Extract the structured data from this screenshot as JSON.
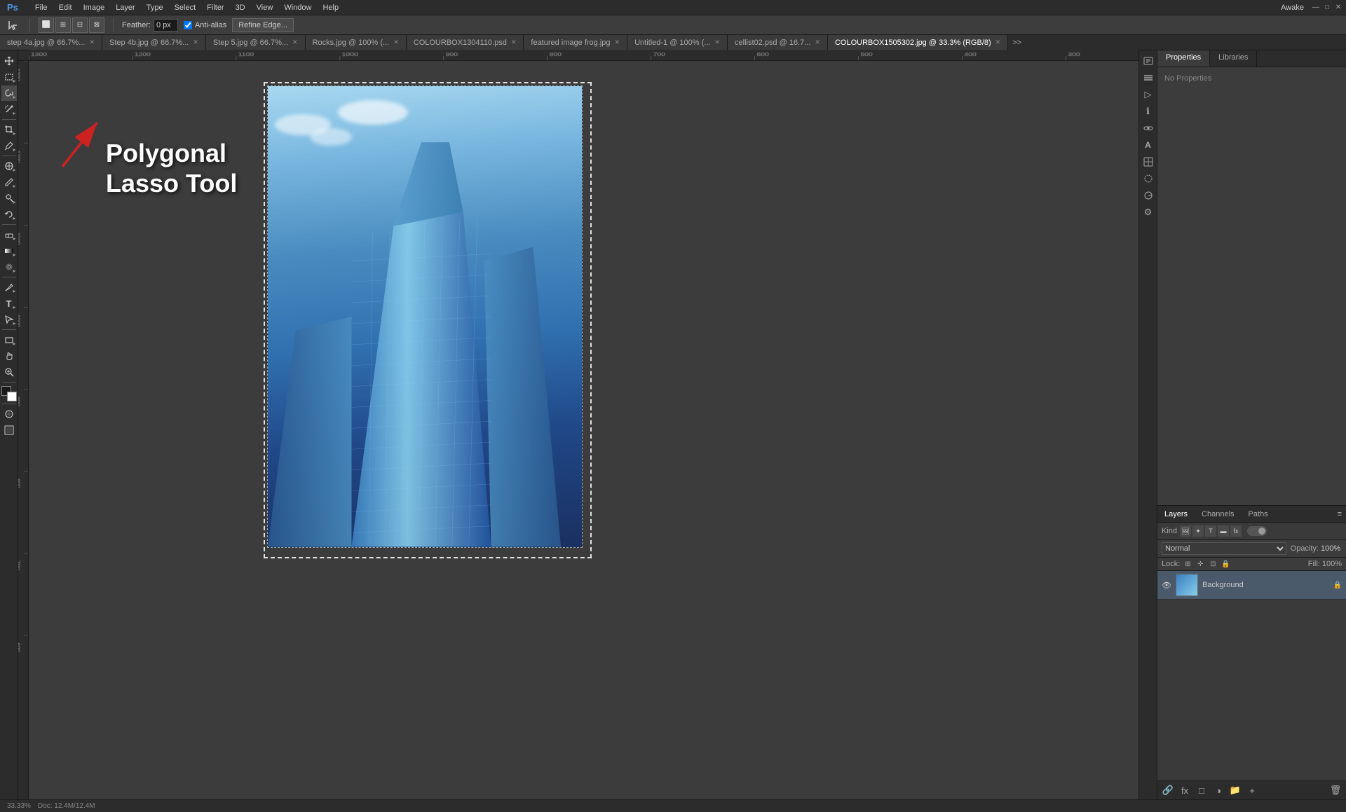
{
  "app": {
    "logo": "Ps",
    "workspace": "Awake"
  },
  "menubar": {
    "items": [
      "File",
      "Edit",
      "Image",
      "Layer",
      "Type",
      "Select",
      "Filter",
      "3D",
      "View",
      "Window",
      "Help"
    ],
    "window_controls": [
      "—",
      "□",
      "✕"
    ]
  },
  "options_bar": {
    "feather_label": "Feather:",
    "feather_value": "0 px",
    "anti_alias_label": "Anti-alias",
    "refine_edge_label": "Refine Edge...",
    "shape_buttons": [
      "□",
      "＋",
      "－"
    ]
  },
  "tabs": [
    {
      "label": "step 4a.jpg @ 66.7%...",
      "active": false
    },
    {
      "label": "Step 4b.jpg @ 66.7%...",
      "active": false
    },
    {
      "label": "Step 5.jpg @ 66.7%...",
      "active": false
    },
    {
      "label": "Rocks.jpg @ 100% (...",
      "active": false
    },
    {
      "label": "COLOURBOX1304110.psd",
      "active": false
    },
    {
      "label": "featured image frog.jpg",
      "active": false
    },
    {
      "label": "Untitled-1 @ 100% (...",
      "active": false
    },
    {
      "label": "cellist02.psd @ 16.7...",
      "active": false
    },
    {
      "label": "COLOURBOX1505302.jpg @ 33.3% (RGB/8)",
      "active": true
    }
  ],
  "toolbar": {
    "tools": [
      {
        "id": "move",
        "icon": "↖",
        "label": "Move Tool"
      },
      {
        "id": "select-rect",
        "icon": "⬜",
        "label": "Rectangular Marquee Tool"
      },
      {
        "id": "lasso",
        "icon": "◌",
        "label": "Lasso Tool",
        "active": true
      },
      {
        "id": "magic-wand",
        "icon": "✦",
        "label": "Magic Wand Tool"
      },
      {
        "id": "crop",
        "icon": "⊞",
        "label": "Crop Tool"
      },
      {
        "id": "eyedropper",
        "icon": "⊘",
        "label": "Eyedropper Tool"
      },
      {
        "id": "patch",
        "icon": "⊕",
        "label": "Patch Tool"
      },
      {
        "id": "brush",
        "icon": "✏",
        "label": "Brush Tool"
      },
      {
        "id": "clone",
        "icon": "⊙",
        "label": "Clone Stamp Tool"
      },
      {
        "id": "history",
        "icon": "↩",
        "label": "History Brush Tool"
      },
      {
        "id": "eraser",
        "icon": "◻",
        "label": "Eraser Tool"
      },
      {
        "id": "gradient",
        "icon": "▣",
        "label": "Gradient Tool"
      },
      {
        "id": "blur",
        "icon": "◍",
        "label": "Blur Tool"
      },
      {
        "id": "dodge",
        "icon": "◎",
        "label": "Dodge Tool"
      },
      {
        "id": "pen",
        "icon": "✒",
        "label": "Pen Tool"
      },
      {
        "id": "type",
        "icon": "T",
        "label": "Type Tool"
      },
      {
        "id": "path-select",
        "icon": "▷",
        "label": "Path Selection Tool"
      },
      {
        "id": "rect-shape",
        "icon": "▬",
        "label": "Rectangle Tool"
      },
      {
        "id": "hand",
        "icon": "✋",
        "label": "Hand Tool"
      },
      {
        "id": "zoom",
        "icon": "🔍",
        "label": "Zoom Tool"
      }
    ],
    "fg_color": "#1a1a1a",
    "bg_color": "#ffffff"
  },
  "annotation": {
    "text": "Polygonal\nLasso Tool",
    "arrow_direction": "top-right"
  },
  "properties_panel": {
    "tabs": [
      "Properties",
      "Libraries"
    ],
    "no_properties_text": "No Properties"
  },
  "layers_panel": {
    "tabs": [
      "Layers",
      "Channels",
      "Paths"
    ],
    "kind_label": "Kind",
    "filter_icons": [
      "🖼",
      "✦",
      "T",
      "⊞",
      "fx"
    ],
    "blend_mode": "Normal",
    "opacity_label": "Opacity:",
    "opacity_value": "100%",
    "fill_label": "Fill:",
    "fill_value": "100%",
    "lock_label": "Lock:",
    "layers": [
      {
        "name": "Background",
        "visible": true,
        "locked": true,
        "type": "image"
      }
    ]
  },
  "status_bar": {
    "zoom": "33.33%",
    "doc_size": "Doc: 12.4M/12.4M"
  },
  "right_icon_bar": {
    "icons": [
      "⊞",
      "☰",
      "▷",
      "ℹ",
      "⊡",
      "A",
      "⊞",
      "⊘",
      "✋",
      "⚙"
    ]
  }
}
